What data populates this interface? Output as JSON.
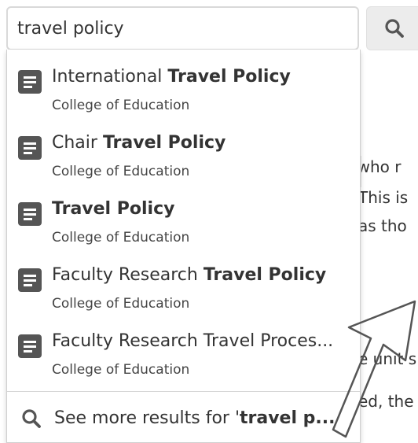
{
  "search": {
    "value": "travel policy",
    "button_icon": "search-icon"
  },
  "background": {
    "line1": "r who r",
    "line2": "This is",
    "line3": "as tho",
    "line4": "e unit s",
    "line5": "ed, the"
  },
  "suggestions": [
    {
      "prefix": "International ",
      "bold": "Travel Policy",
      "suffix": "",
      "subtitle": "College of Education",
      "icon": "document-icon"
    },
    {
      "prefix": "Chair ",
      "bold": "Travel Policy",
      "suffix": "",
      "subtitle": "College of Education",
      "icon": "document-icon"
    },
    {
      "prefix": "",
      "bold": "Travel Policy",
      "suffix": "",
      "subtitle": "College of Education",
      "icon": "document-icon"
    },
    {
      "prefix": "Faculty Research ",
      "bold": "Travel Policy",
      "suffix": "",
      "subtitle": "College of Education",
      "icon": "document-icon"
    },
    {
      "prefix": "Faculty Research Travel Proces...",
      "bold": "",
      "suffix": "",
      "subtitle": "College of Education",
      "icon": "document-icon"
    }
  ],
  "see_more": {
    "prefix": "See more results for '",
    "bold": "travel p...",
    "icon": "search-icon"
  },
  "colors": {
    "icon_bg": "#555555",
    "text": "#333333",
    "border": "#d9d9d9"
  }
}
